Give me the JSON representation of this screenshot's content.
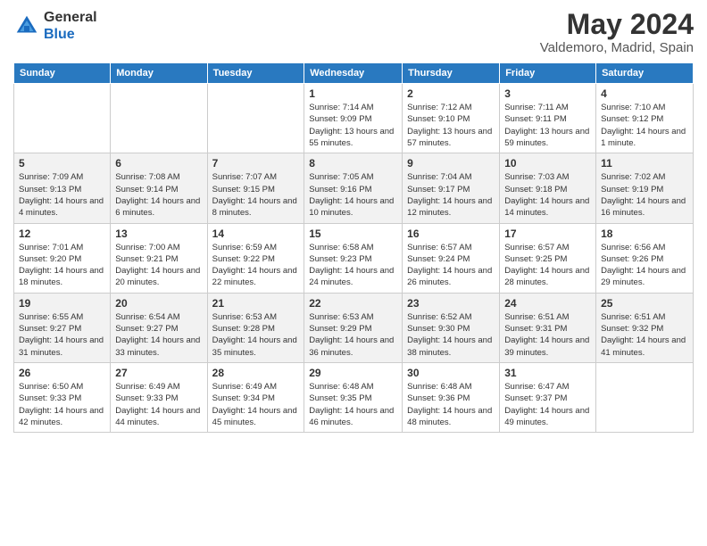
{
  "header": {
    "logo_general": "General",
    "logo_blue": "Blue",
    "month_year": "May 2024",
    "location": "Valdemoro, Madrid, Spain"
  },
  "weekdays": [
    "Sunday",
    "Monday",
    "Tuesday",
    "Wednesday",
    "Thursday",
    "Friday",
    "Saturday"
  ],
  "weeks": [
    [
      {
        "day": "",
        "sunrise": "",
        "sunset": "",
        "daylight": ""
      },
      {
        "day": "",
        "sunrise": "",
        "sunset": "",
        "daylight": ""
      },
      {
        "day": "",
        "sunrise": "",
        "sunset": "",
        "daylight": ""
      },
      {
        "day": "1",
        "sunrise": "Sunrise: 7:14 AM",
        "sunset": "Sunset: 9:09 PM",
        "daylight": "Daylight: 13 hours and 55 minutes."
      },
      {
        "day": "2",
        "sunrise": "Sunrise: 7:12 AM",
        "sunset": "Sunset: 9:10 PM",
        "daylight": "Daylight: 13 hours and 57 minutes."
      },
      {
        "day": "3",
        "sunrise": "Sunrise: 7:11 AM",
        "sunset": "Sunset: 9:11 PM",
        "daylight": "Daylight: 13 hours and 59 minutes."
      },
      {
        "day": "4",
        "sunrise": "Sunrise: 7:10 AM",
        "sunset": "Sunset: 9:12 PM",
        "daylight": "Daylight: 14 hours and 1 minute."
      }
    ],
    [
      {
        "day": "5",
        "sunrise": "Sunrise: 7:09 AM",
        "sunset": "Sunset: 9:13 PM",
        "daylight": "Daylight: 14 hours and 4 minutes."
      },
      {
        "day": "6",
        "sunrise": "Sunrise: 7:08 AM",
        "sunset": "Sunset: 9:14 PM",
        "daylight": "Daylight: 14 hours and 6 minutes."
      },
      {
        "day": "7",
        "sunrise": "Sunrise: 7:07 AM",
        "sunset": "Sunset: 9:15 PM",
        "daylight": "Daylight: 14 hours and 8 minutes."
      },
      {
        "day": "8",
        "sunrise": "Sunrise: 7:05 AM",
        "sunset": "Sunset: 9:16 PM",
        "daylight": "Daylight: 14 hours and 10 minutes."
      },
      {
        "day": "9",
        "sunrise": "Sunrise: 7:04 AM",
        "sunset": "Sunset: 9:17 PM",
        "daylight": "Daylight: 14 hours and 12 minutes."
      },
      {
        "day": "10",
        "sunrise": "Sunrise: 7:03 AM",
        "sunset": "Sunset: 9:18 PM",
        "daylight": "Daylight: 14 hours and 14 minutes."
      },
      {
        "day": "11",
        "sunrise": "Sunrise: 7:02 AM",
        "sunset": "Sunset: 9:19 PM",
        "daylight": "Daylight: 14 hours and 16 minutes."
      }
    ],
    [
      {
        "day": "12",
        "sunrise": "Sunrise: 7:01 AM",
        "sunset": "Sunset: 9:20 PM",
        "daylight": "Daylight: 14 hours and 18 minutes."
      },
      {
        "day": "13",
        "sunrise": "Sunrise: 7:00 AM",
        "sunset": "Sunset: 9:21 PM",
        "daylight": "Daylight: 14 hours and 20 minutes."
      },
      {
        "day": "14",
        "sunrise": "Sunrise: 6:59 AM",
        "sunset": "Sunset: 9:22 PM",
        "daylight": "Daylight: 14 hours and 22 minutes."
      },
      {
        "day": "15",
        "sunrise": "Sunrise: 6:58 AM",
        "sunset": "Sunset: 9:23 PM",
        "daylight": "Daylight: 14 hours and 24 minutes."
      },
      {
        "day": "16",
        "sunrise": "Sunrise: 6:57 AM",
        "sunset": "Sunset: 9:24 PM",
        "daylight": "Daylight: 14 hours and 26 minutes."
      },
      {
        "day": "17",
        "sunrise": "Sunrise: 6:57 AM",
        "sunset": "Sunset: 9:25 PM",
        "daylight": "Daylight: 14 hours and 28 minutes."
      },
      {
        "day": "18",
        "sunrise": "Sunrise: 6:56 AM",
        "sunset": "Sunset: 9:26 PM",
        "daylight": "Daylight: 14 hours and 29 minutes."
      }
    ],
    [
      {
        "day": "19",
        "sunrise": "Sunrise: 6:55 AM",
        "sunset": "Sunset: 9:27 PM",
        "daylight": "Daylight: 14 hours and 31 minutes."
      },
      {
        "day": "20",
        "sunrise": "Sunrise: 6:54 AM",
        "sunset": "Sunset: 9:27 PM",
        "daylight": "Daylight: 14 hours and 33 minutes."
      },
      {
        "day": "21",
        "sunrise": "Sunrise: 6:53 AM",
        "sunset": "Sunset: 9:28 PM",
        "daylight": "Daylight: 14 hours and 35 minutes."
      },
      {
        "day": "22",
        "sunrise": "Sunrise: 6:53 AM",
        "sunset": "Sunset: 9:29 PM",
        "daylight": "Daylight: 14 hours and 36 minutes."
      },
      {
        "day": "23",
        "sunrise": "Sunrise: 6:52 AM",
        "sunset": "Sunset: 9:30 PM",
        "daylight": "Daylight: 14 hours and 38 minutes."
      },
      {
        "day": "24",
        "sunrise": "Sunrise: 6:51 AM",
        "sunset": "Sunset: 9:31 PM",
        "daylight": "Daylight: 14 hours and 39 minutes."
      },
      {
        "day": "25",
        "sunrise": "Sunrise: 6:51 AM",
        "sunset": "Sunset: 9:32 PM",
        "daylight": "Daylight: 14 hours and 41 minutes."
      }
    ],
    [
      {
        "day": "26",
        "sunrise": "Sunrise: 6:50 AM",
        "sunset": "Sunset: 9:33 PM",
        "daylight": "Daylight: 14 hours and 42 minutes."
      },
      {
        "day": "27",
        "sunrise": "Sunrise: 6:49 AM",
        "sunset": "Sunset: 9:33 PM",
        "daylight": "Daylight: 14 hours and 44 minutes."
      },
      {
        "day": "28",
        "sunrise": "Sunrise: 6:49 AM",
        "sunset": "Sunset: 9:34 PM",
        "daylight": "Daylight: 14 hours and 45 minutes."
      },
      {
        "day": "29",
        "sunrise": "Sunrise: 6:48 AM",
        "sunset": "Sunset: 9:35 PM",
        "daylight": "Daylight: 14 hours and 46 minutes."
      },
      {
        "day": "30",
        "sunrise": "Sunrise: 6:48 AM",
        "sunset": "Sunset: 9:36 PM",
        "daylight": "Daylight: 14 hours and 48 minutes."
      },
      {
        "day": "31",
        "sunrise": "Sunrise: 6:47 AM",
        "sunset": "Sunset: 9:37 PM",
        "daylight": "Daylight: 14 hours and 49 minutes."
      },
      {
        "day": "",
        "sunrise": "",
        "sunset": "",
        "daylight": ""
      }
    ]
  ]
}
